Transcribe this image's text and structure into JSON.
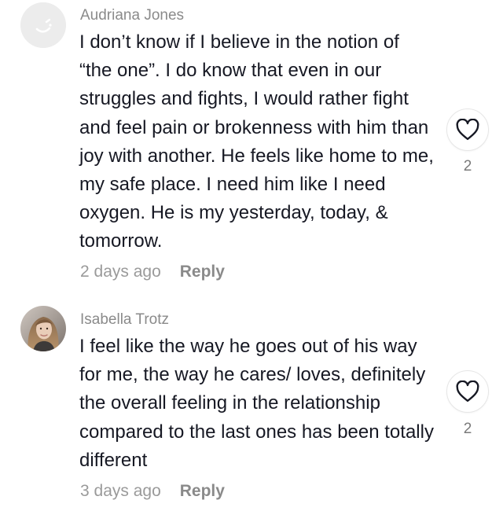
{
  "comments": [
    {
      "author": "Audriana Jones",
      "avatar_icon": "default-avatar-icon",
      "text": "I don’t know if I believe in the notion of “the one”. I do know that even in our struggles and fights, I would rather fight and feel pain or brokenness with him than joy with another. He feels like home to me, my safe place. I need him like I need oxygen. He is my yesterday, today, & tomorrow.",
      "timestamp": "2 days ago",
      "reply_label": "Reply",
      "like_icon": "heart-outline-icon",
      "like_count": "2"
    },
    {
      "author": "Isabella Trotz",
      "avatar_icon": "profile-photo",
      "text": "I feel like the way he goes out of his way for me, the way he cares/ loves, definitely the overall feeling in the relationship compared to the last ones has been totally different",
      "timestamp": "3 days ago",
      "reply_label": "Reply",
      "like_icon": "heart-outline-icon",
      "like_count": "2"
    }
  ],
  "colors": {
    "author": "#8a8a8a",
    "body_text": "#161823",
    "timestamp": "#9a9a9a",
    "reply": "#8a8a8a",
    "like_count": "#7a7a7a",
    "default_avatar_bg": "#ececec"
  }
}
